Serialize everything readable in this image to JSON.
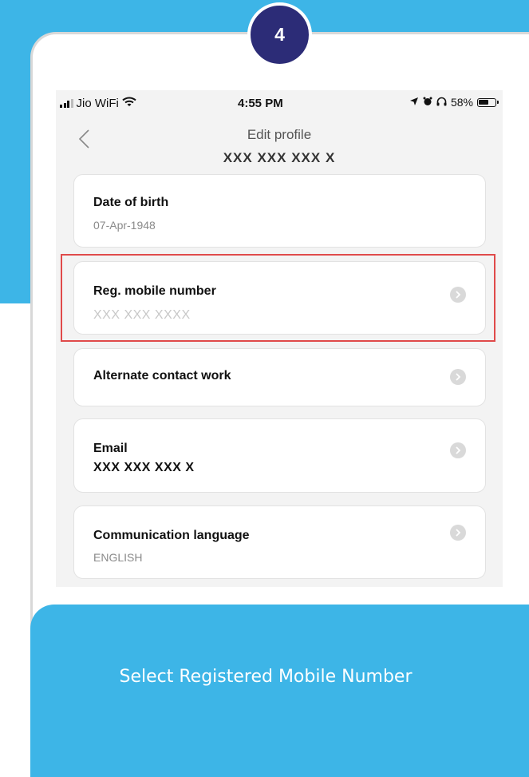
{
  "step_number": "4",
  "status_bar": {
    "carrier": "Jio WiFi",
    "time": "4:55 PM",
    "battery_percent": "58%"
  },
  "header": {
    "title": "Edit profile",
    "subtitle": "XXX XXX XXX X"
  },
  "profile_rows": [
    {
      "label": "Date of birth",
      "value": "07-Apr-1948"
    },
    {
      "label": "Reg. mobile number",
      "value": "XXX XXX XXXX"
    },
    {
      "label": "Alternate contact work",
      "value": ""
    },
    {
      "label": "Email",
      "value": "XXX XXX XXX X"
    },
    {
      "label": "Communication language",
      "value": "ENGLISH"
    }
  ],
  "highlighted_row": "Reg. mobile number",
  "instruction": "Select Registered Mobile Number",
  "colors": {
    "background_blue": "#3db5e7",
    "badge_navy": "#2c2c77",
    "highlight_red": "#e04a4a"
  },
  "icons": [
    "signal-icon",
    "wifi-icon",
    "location-arrow-icon",
    "alarm-icon",
    "headphones-icon",
    "battery-icon",
    "back-chevron-icon",
    "chevron-right-icon"
  ]
}
